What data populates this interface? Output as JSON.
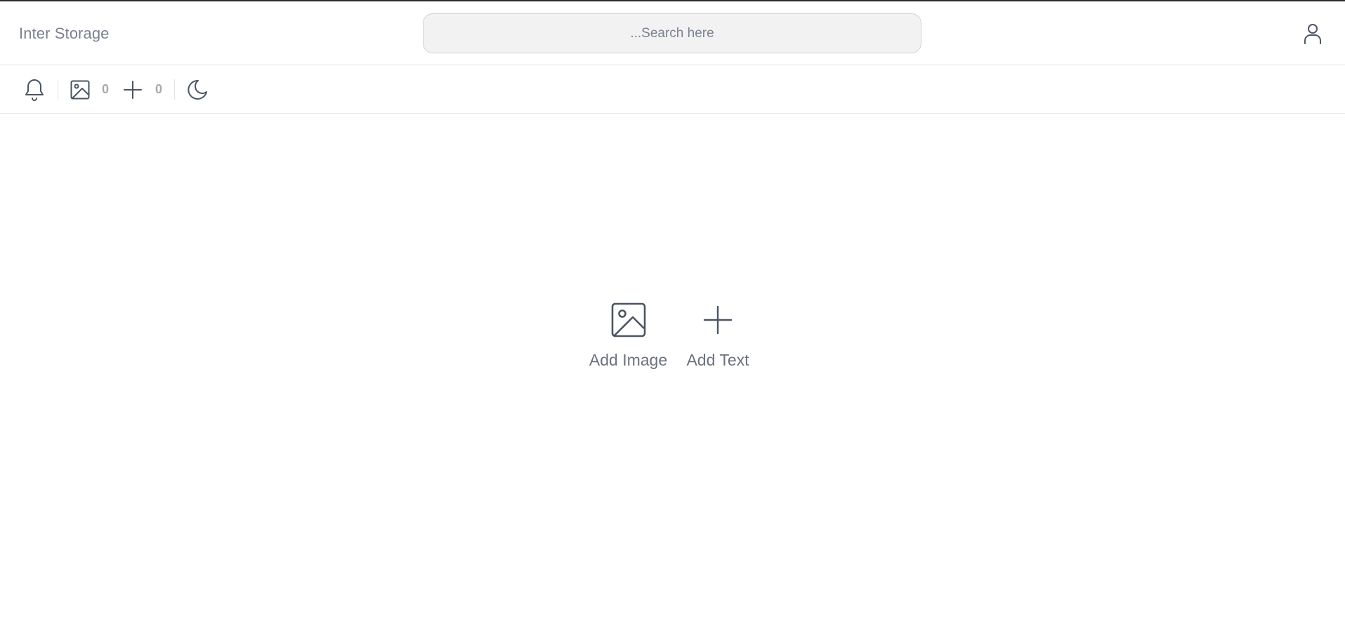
{
  "header": {
    "brand": "Inter Storage",
    "search_placeholder": "...Search here",
    "user_icon": "user-icon"
  },
  "toolbar": {
    "notifications_icon": "bell-icon",
    "images_icon": "image-icon",
    "images_count": "0",
    "texts_icon": "plus-icon",
    "texts_count": "0",
    "theme_icon": "moon-icon"
  },
  "actions": {
    "add_image_label": "Add Image",
    "add_text_label": "Add Text"
  },
  "colors": {
    "icon": "#4b5563",
    "text": "#6b7280",
    "muted_count": "#a6a9ae",
    "search_bg": "#f2f2f2",
    "divider": "#e5e7eb"
  }
}
